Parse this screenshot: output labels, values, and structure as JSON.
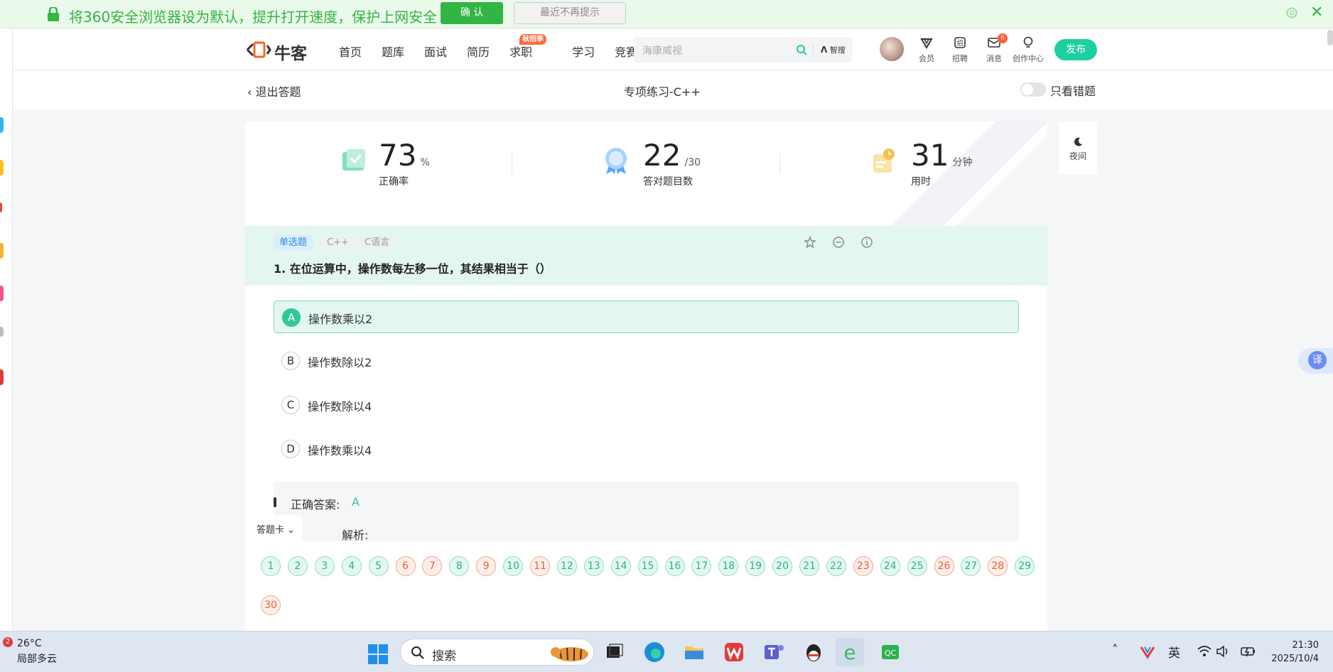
{
  "promo": {
    "message": "将360安全浏览器设为默认，提升打开速度，保护上网安全",
    "confirm": "确 认",
    "dismiss": "最近不再提示",
    "close": "✕",
    "color": "#32b544"
  },
  "nav": {
    "brand": "牛客",
    "menu": [
      "首页",
      "题库",
      "面试",
      "简历",
      "求职",
      "学习",
      "竞赛"
    ],
    "hot_badge": "秋招季",
    "search_placeholder": "海康威视",
    "smart_search": "智搜",
    "items": [
      {
        "label": "会员",
        "icon": "vip-icon"
      },
      {
        "label": "招聘",
        "icon": "recruit-icon"
      },
      {
        "label": "消息",
        "icon": "message-icon",
        "badge": "6"
      },
      {
        "label": "创作中心",
        "icon": "creator-icon"
      }
    ],
    "publish": "发布",
    "accent": "#1ecfa0"
  },
  "subheader": {
    "back": "退出答题",
    "title": "专项练习-C++",
    "only_wrong": "只看错题",
    "only_wrong_on": false
  },
  "stats": {
    "accuracy": {
      "value": "73",
      "unit": "%",
      "label": "正确率"
    },
    "correct": {
      "value": "22",
      "unit": "/30",
      "label": "答对题目数"
    },
    "time": {
      "value": "31",
      "unit": "分钟",
      "label": "用时"
    }
  },
  "night_mode": {
    "label": "夜间"
  },
  "question": {
    "tags": [
      "单选题",
      "C++",
      "C语言"
    ],
    "text": "1. 在位运算中，操作数每左移一位，其结果相当于（）",
    "options": [
      {
        "letter": "A",
        "text": "操作数乘以2",
        "selected": true
      },
      {
        "letter": "B",
        "text": "操作数除以2",
        "selected": false
      },
      {
        "letter": "C",
        "text": "操作数除以4",
        "selected": false
      },
      {
        "letter": "D",
        "text": "操作数乘以4",
        "selected": false
      }
    ],
    "answer_label": "正确答案:",
    "answer_value": "A",
    "analysis_label": "解析:"
  },
  "answer_card": {
    "label": "答题卡",
    "questions": [
      {
        "n": "1",
        "ok": true
      },
      {
        "n": "2",
        "ok": true
      },
      {
        "n": "3",
        "ok": true
      },
      {
        "n": "4",
        "ok": true
      },
      {
        "n": "5",
        "ok": true
      },
      {
        "n": "6",
        "ok": false
      },
      {
        "n": "7",
        "ok": false
      },
      {
        "n": "8",
        "ok": true
      },
      {
        "n": "9",
        "ok": false
      },
      {
        "n": "10",
        "ok": true
      },
      {
        "n": "11",
        "ok": false
      },
      {
        "n": "12",
        "ok": true
      },
      {
        "n": "13",
        "ok": true
      },
      {
        "n": "14",
        "ok": true
      },
      {
        "n": "15",
        "ok": true
      },
      {
        "n": "16",
        "ok": true
      },
      {
        "n": "17",
        "ok": true
      },
      {
        "n": "18",
        "ok": true
      },
      {
        "n": "19",
        "ok": true
      },
      {
        "n": "20",
        "ok": true
      },
      {
        "n": "21",
        "ok": true
      },
      {
        "n": "22",
        "ok": true
      },
      {
        "n": "23",
        "ok": false
      },
      {
        "n": "24",
        "ok": true
      },
      {
        "n": "25",
        "ok": true
      },
      {
        "n": "26",
        "ok": false
      },
      {
        "n": "27",
        "ok": true
      },
      {
        "n": "28",
        "ok": false
      },
      {
        "n": "29",
        "ok": true
      },
      {
        "n": "30",
        "ok": false
      }
    ]
  },
  "translate": {
    "label": "译"
  },
  "taskbar": {
    "weather_badge": "2",
    "temperature": "26°C",
    "weather": "局部多云",
    "search": "搜索",
    "ime": "英",
    "time": "21:30",
    "date": "2025/10/4"
  }
}
